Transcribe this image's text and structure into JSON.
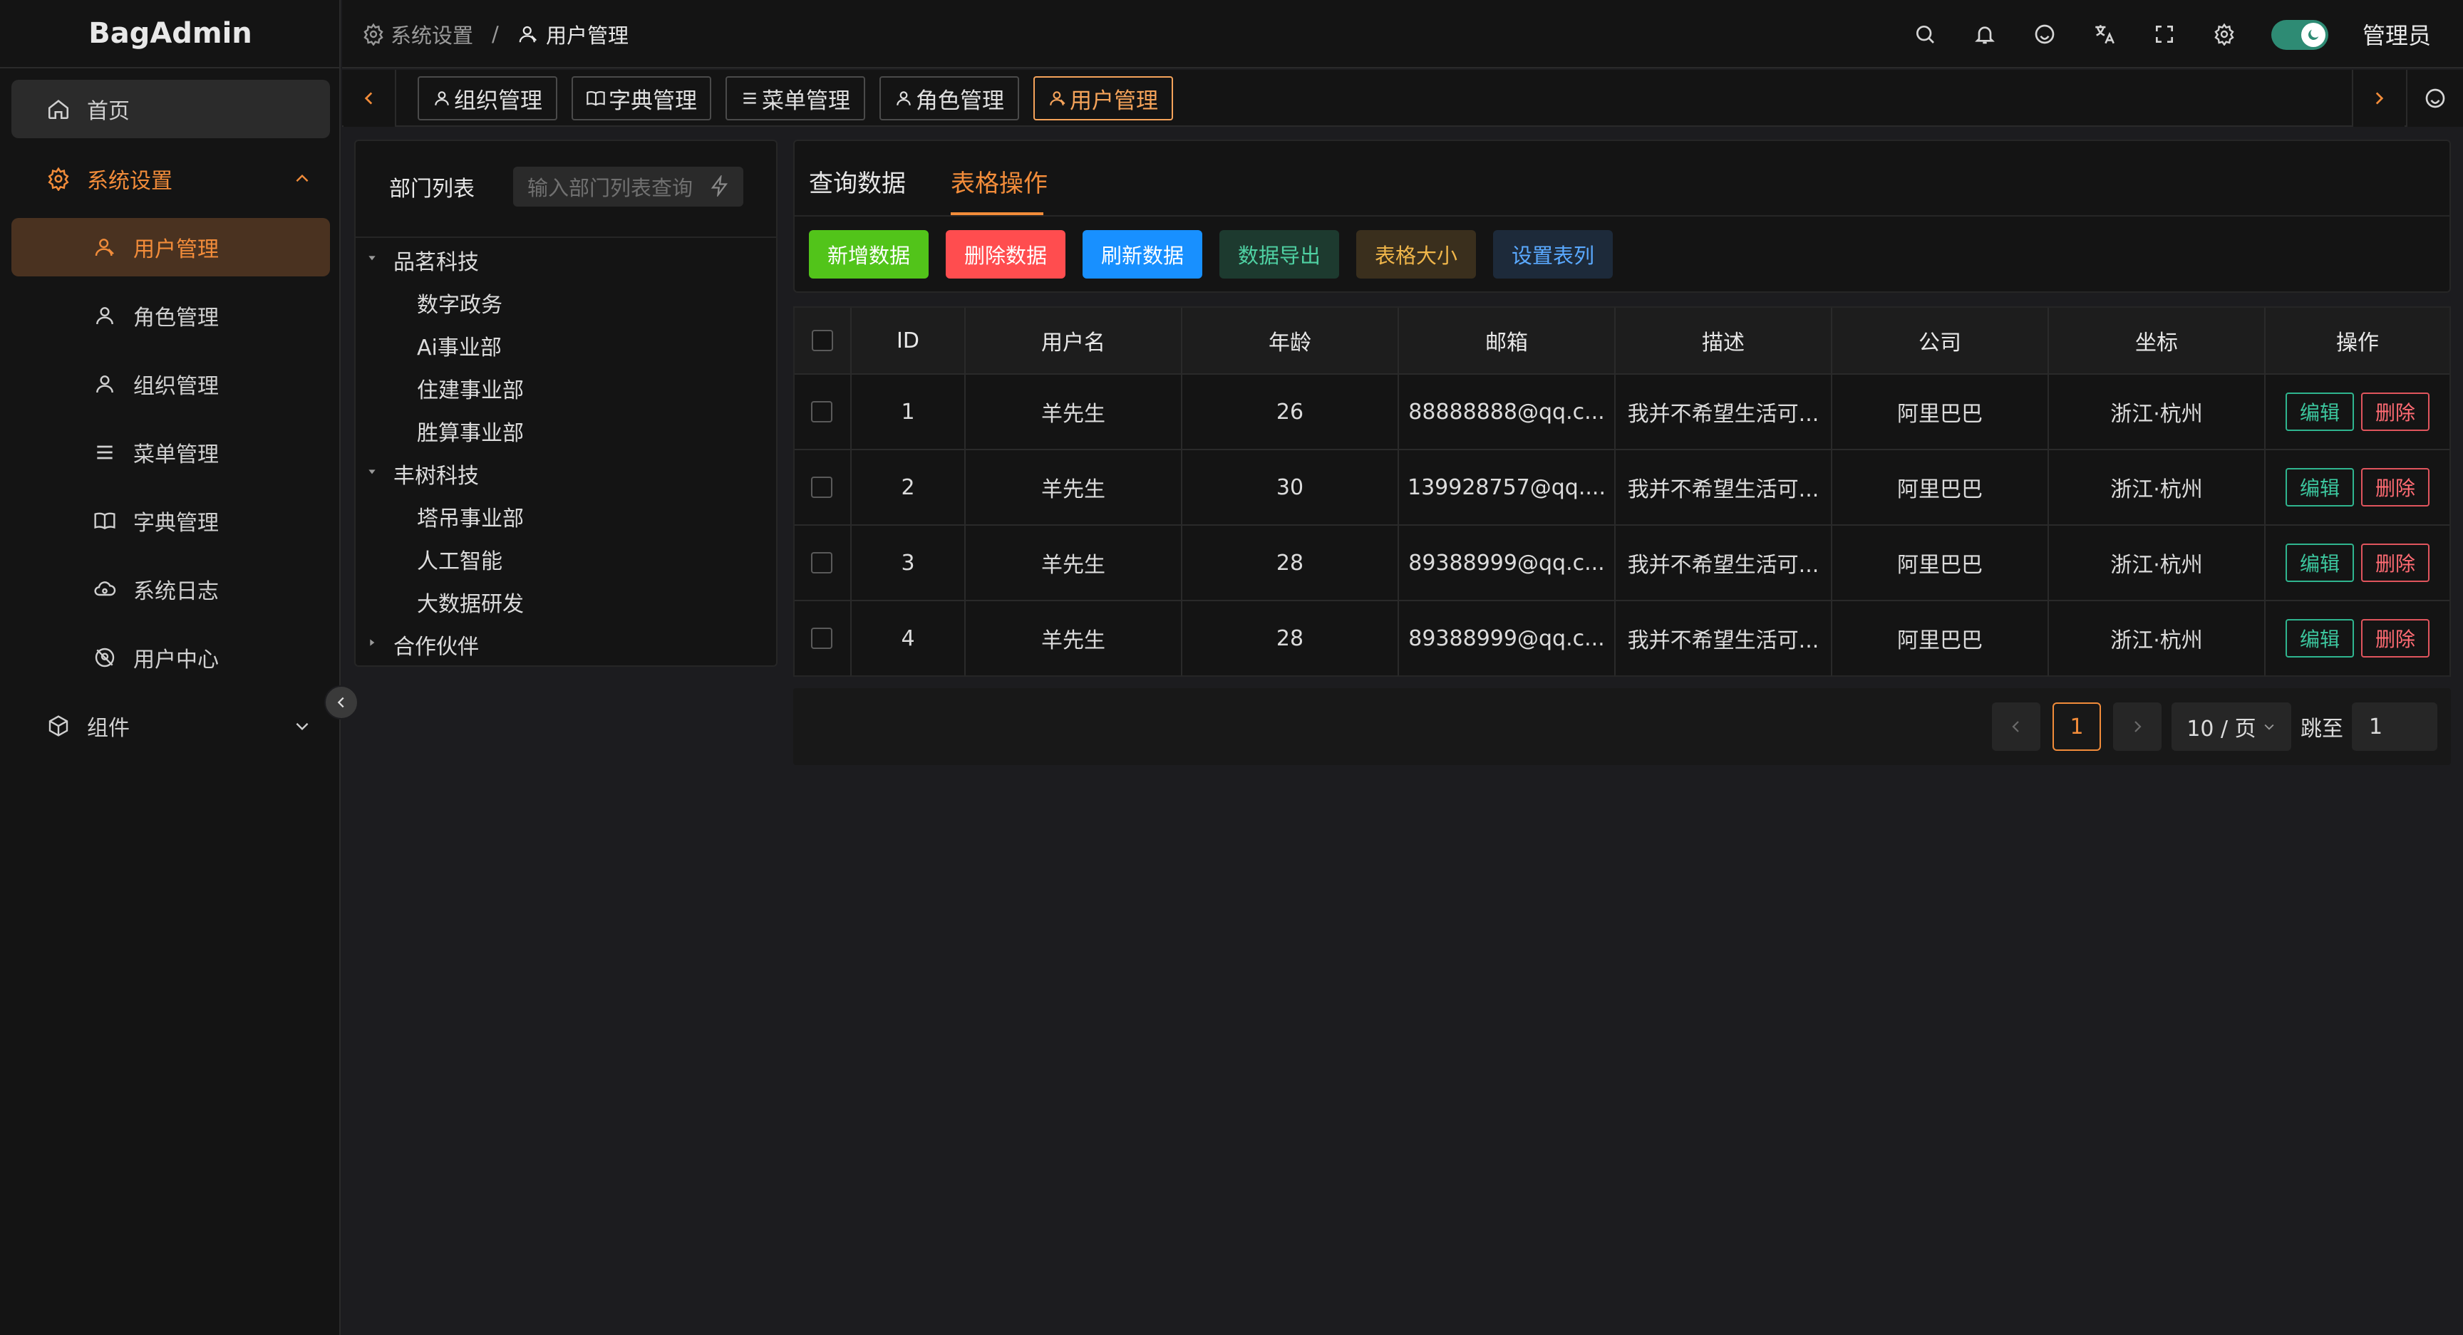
{
  "app": {
    "title": "BagAdmin"
  },
  "sidebar": {
    "items": [
      {
        "label": "首页",
        "icon": "home-icon"
      },
      {
        "label": "系统设置",
        "icon": "gear-icon"
      },
      {
        "label": "用户管理",
        "icon": "user-icon"
      },
      {
        "label": "角色管理",
        "icon": "user-icon"
      },
      {
        "label": "组织管理",
        "icon": "user-icon"
      },
      {
        "label": "菜单管理",
        "icon": "list-icon"
      },
      {
        "label": "字典管理",
        "icon": "book-icon"
      },
      {
        "label": "系统日志",
        "icon": "cloud-icon"
      },
      {
        "label": "用户中心",
        "icon": "user-center-icon"
      },
      {
        "label": "组件",
        "icon": "cube-icon"
      }
    ]
  },
  "header": {
    "breadcrumb": [
      "系统设置",
      "/",
      "用户管理"
    ],
    "user_name": "管理员"
  },
  "tabs": [
    "组织管理",
    "字典管理",
    "菜单管理",
    "角色管理",
    "用户管理"
  ],
  "dept": {
    "title": "部门列表",
    "search_placeholder": "输入部门列表查询",
    "tree": [
      {
        "label": "品茗科技",
        "level": 0,
        "caret": "down"
      },
      {
        "label": "数字政务",
        "level": 1
      },
      {
        "label": "Ai事业部",
        "level": 1
      },
      {
        "label": "住建事业部",
        "level": 1
      },
      {
        "label": "胜算事业部",
        "level": 1
      },
      {
        "label": "丰树科技",
        "level": 0,
        "caret": "down"
      },
      {
        "label": "塔吊事业部",
        "level": 1
      },
      {
        "label": "人工智能",
        "level": 1
      },
      {
        "label": "大数据研发",
        "level": 1
      },
      {
        "label": "合作伙伴",
        "level": 0,
        "caret": "right"
      }
    ]
  },
  "main": {
    "tabs": [
      "查询数据",
      "表格操作"
    ],
    "actions": [
      "新增数据",
      "删除数据",
      "刷新数据",
      "数据导出",
      "表格大小",
      "设置表列"
    ]
  },
  "table": {
    "columns": [
      "ID",
      "用户名",
      "年龄",
      "邮箱",
      "描述",
      "公司",
      "坐标",
      "操作"
    ],
    "rows": [
      [
        "1",
        "羊先生",
        "26",
        "88888888@qq.c...",
        "我并不希望生活可...",
        "阿里巴巴",
        "浙江·杭州"
      ],
      [
        "2",
        "羊先生",
        "30",
        "139928757@qq....",
        "我并不希望生活可...",
        "阿里巴巴",
        "浙江·杭州"
      ],
      [
        "3",
        "羊先生",
        "28",
        "89388999@qq.c...",
        "我并不希望生活可...",
        "阿里巴巴",
        "浙江·杭州"
      ],
      [
        "4",
        "羊先生",
        "28",
        "89388999@qq.c...",
        "我并不希望生活可...",
        "阿里巴巴",
        "浙江·杭州"
      ]
    ],
    "edit_label": "编辑",
    "delete_label": "删除"
  },
  "pagination": {
    "current_page": "1",
    "page_size": "10 / 页",
    "jump_label": "跳至",
    "jump_value": "1"
  },
  "colors": {
    "accent": "#f28c3a",
    "add": "#52c41a",
    "delete": "#ff4d4f",
    "refresh": "#1890ff",
    "edit": "#2fb58f"
  }
}
